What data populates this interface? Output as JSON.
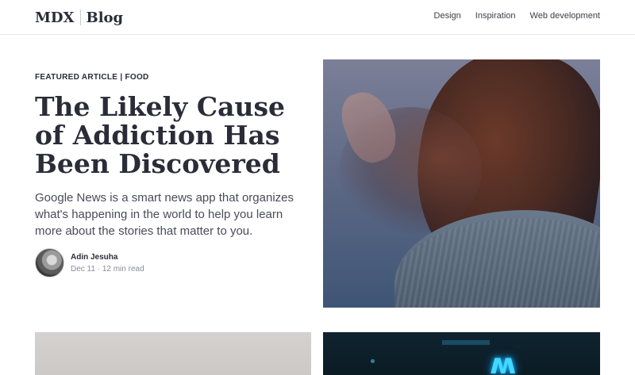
{
  "header": {
    "brand_left": "MDX",
    "brand_right": "Blog",
    "nav": [
      "Design",
      "Inspiration",
      "Web development"
    ]
  },
  "featured": {
    "eyebrow": "FEATURED ARTICLE | FOOD",
    "title": "The Likely Cause of Addiction Has Been Discovered",
    "excerpt": "Google News is a smart news app that organizes what's happening in the world to help you learn more about the stories that matter to you.",
    "author_name": "Adin Jesuha",
    "meta": "Dec 11 · 12 min read"
  },
  "colors": {
    "text": "#2b2c38",
    "neon": "#43d8ff"
  }
}
